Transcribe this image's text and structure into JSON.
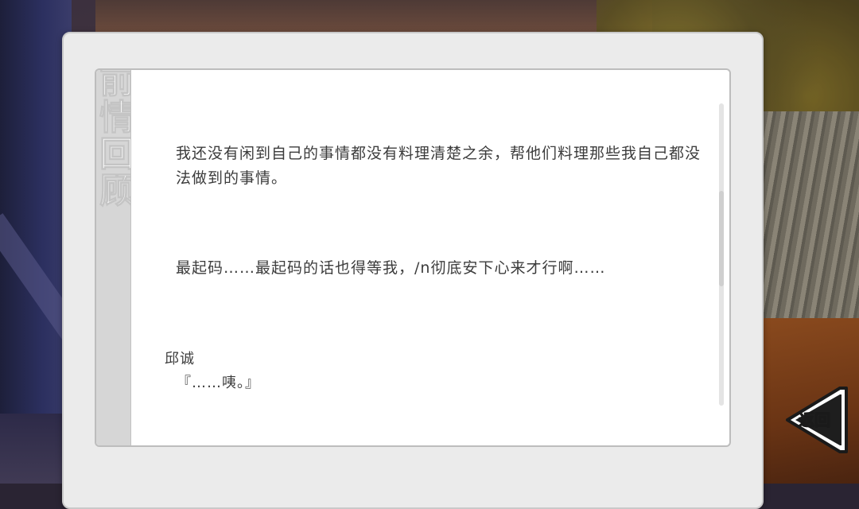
{
  "backlog": {
    "title": "前情回顾",
    "entries": [
      {
        "text": "我还没有闲到自己的事情都没有料理清楚之余，帮他们料理那些我自己都没法做到的事情。"
      },
      {
        "text": "最起码……最起码的话也得等我，/n彻底安下心来才行啊……"
      },
      {
        "speaker": "邱诚",
        "text": "『……咦。』"
      }
    ]
  },
  "controls": {
    "back_label": "返回",
    "back_icon": "arrow-left-icon"
  },
  "colors": {
    "panel_bg": "#ebebeb",
    "text": "#3c3c3c",
    "strip": "#d6d6d6"
  }
}
